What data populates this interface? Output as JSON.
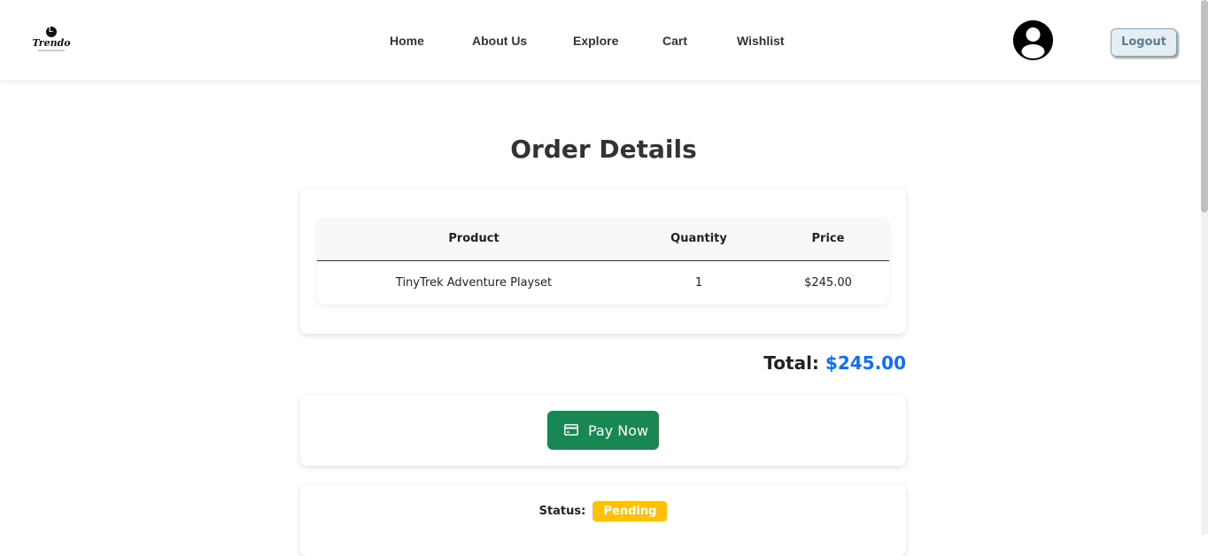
{
  "brand": {
    "name": "Trendo"
  },
  "nav": {
    "links": [
      "Home",
      "About Us",
      "Explore",
      "Cart",
      "Wishlist"
    ],
    "logout_label": "Logout"
  },
  "page": {
    "title": "Order Details"
  },
  "order_table": {
    "headers": [
      "Product",
      "Quantity",
      "Price"
    ],
    "rows": [
      {
        "product": "TinyTrek Adventure Playset",
        "quantity": "1",
        "price": "$245.00"
      }
    ]
  },
  "total": {
    "label": "Total:",
    "amount": "$245.00"
  },
  "payment": {
    "button_label": "Pay Now",
    "button_icon": "credit-card-icon"
  },
  "status": {
    "label": "Status:",
    "value": "Pending"
  },
  "colors": {
    "accent_blue": "#0d6efd",
    "pay_green": "#198754",
    "pending_yellow": "#ffc107",
    "logout_bg": "#e4eef3"
  }
}
